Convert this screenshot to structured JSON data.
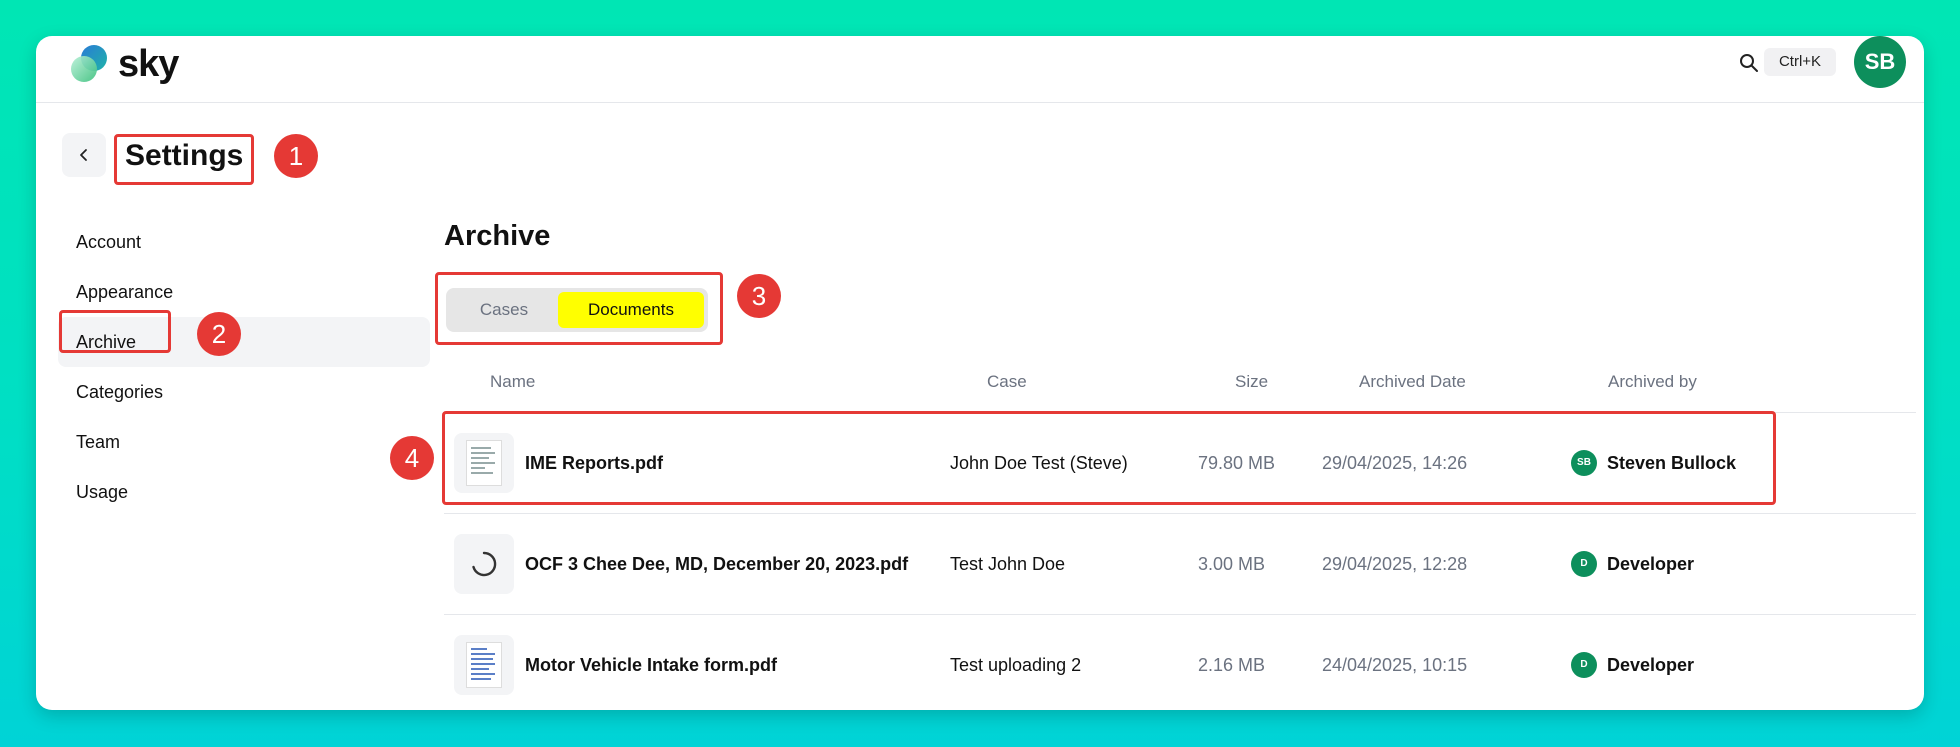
{
  "app": {
    "logo_text": "sky"
  },
  "header": {
    "shortcut_label": "Ctrl+K",
    "user_initials": "SB"
  },
  "settings": {
    "title": "Settings"
  },
  "sidebar": {
    "items": [
      {
        "label": "Account"
      },
      {
        "label": "Appearance"
      },
      {
        "label": "Archive"
      },
      {
        "label": "Categories"
      },
      {
        "label": "Team"
      },
      {
        "label": "Usage"
      }
    ]
  },
  "main": {
    "heading": "Archive",
    "tabs": [
      {
        "label": "Cases"
      },
      {
        "label": "Documents"
      }
    ],
    "columns": {
      "name": "Name",
      "case": "Case",
      "size": "Size",
      "archived_date": "Archived Date",
      "archived_by": "Archived by"
    },
    "rows": [
      {
        "name": "IME Reports.pdf",
        "case": "John Doe Test (Steve)",
        "size": "79.80 MB",
        "date": "29/04/2025, 14:26",
        "by": "Steven Bullock",
        "by_initials": "SB",
        "thumb": "document-thumbnail"
      },
      {
        "name": "OCF 3 Chee Dee, MD, December 20, 2023.pdf",
        "case": "Test John Doe",
        "size": "3.00 MB",
        "date": "29/04/2025, 12:28",
        "by": "Developer",
        "by_initials": "D",
        "thumb": "loading-spinner"
      },
      {
        "name": "Motor Vehicle Intake form.pdf",
        "case": "Test uploading 2",
        "size": "2.16 MB",
        "date": "24/04/2025, 10:15",
        "by": "Developer",
        "by_initials": "D",
        "thumb": "document-thumbnail"
      }
    ]
  },
  "annotations": [
    "1",
    "2",
    "3",
    "4"
  ],
  "colors": {
    "accent_green": "#0d8f5c",
    "annotation_red": "#e53935",
    "highlight_yellow": "#ffff00"
  }
}
